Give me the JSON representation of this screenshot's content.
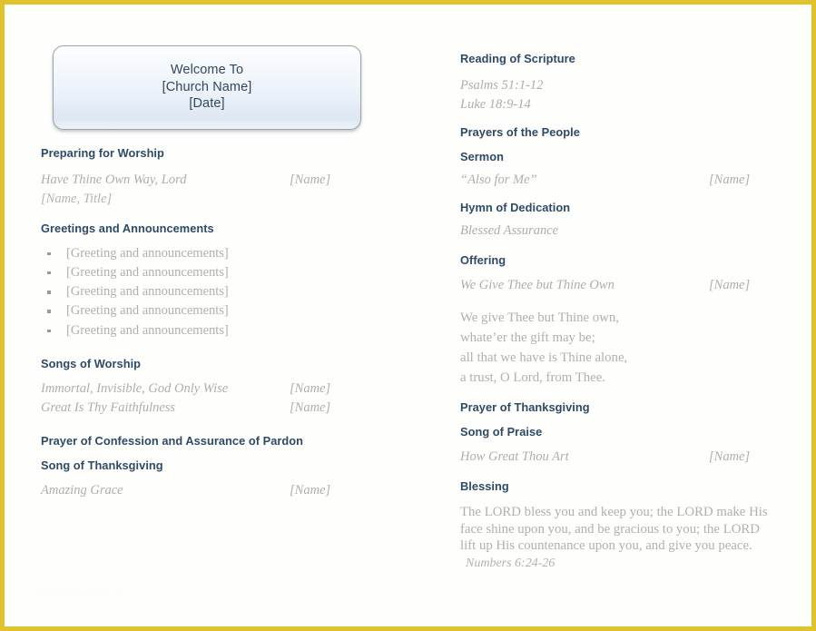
{
  "page": {
    "border_color": "#dfc22c",
    "background": "#fefefd",
    "heading_color": "#2d4a66",
    "body_color": "#b0b0b0",
    "watermark": "www.templateshub.com"
  },
  "welcome_box": {
    "line1": "Welcome To",
    "line2": "[Church Name]",
    "line3": "[Date]"
  },
  "left_column": {
    "preparing": {
      "heading": "Preparing for Worship",
      "song_title": "Have Thine Own Way, Lord",
      "song_name": "[Name]",
      "subline": "[Name, Title]"
    },
    "greetings": {
      "heading": "Greetings and Announcements",
      "items": [
        "[Greeting and announcements]",
        "[Greeting and announcements]",
        "[Greeting and announcements]",
        "[Greeting and announcements]",
        "[Greeting and announcements]"
      ]
    },
    "songs_of_worship": {
      "heading": "Songs of Worship",
      "entries": [
        {
          "title": "Immortal, Invisible, God Only Wise",
          "name": "[Name]"
        },
        {
          "title": "Great Is Thy Faithfulness",
          "name": "[Name]"
        }
      ]
    },
    "prayer_of_confession": {
      "heading": "Prayer of Confession and Assurance of Pardon"
    },
    "song_of_thanksgiving": {
      "heading": "Song of Thanksgiving",
      "entries": [
        {
          "title": "Amazing Grace",
          "name": "[Name]"
        }
      ]
    }
  },
  "right_column": {
    "reading_of_scripture": {
      "heading": "Reading of Scripture",
      "readings": [
        "Psalms 51:1-12",
        "Luke 18:9-14"
      ]
    },
    "prayers_of_the_people": {
      "heading": "Prayers of the People"
    },
    "sermon": {
      "heading": "Sermon",
      "title": "“Also for Me”",
      "name": "[Name]"
    },
    "hymn_of_dedication": {
      "heading": "Hymn of Dedication",
      "title": "Blessed Assurance"
    },
    "offering": {
      "heading": "Offering",
      "title": "We Give Thee but Thine Own",
      "name": "[Name]",
      "verse_lines": [
        "We give Thee but Thine own,",
        "whate’er the gift may be;",
        "all that we have is Thine alone,",
        "a trust, O Lord, from Thee."
      ]
    },
    "prayer_of_thanksgiving": {
      "heading": "Prayer of Thanksgiving"
    },
    "song_of_praise": {
      "heading": "Song of Praise",
      "title": "How Great Thou Art",
      "name": "[Name]"
    },
    "blessing": {
      "heading": "Blessing",
      "text": "The LORD bless you and keep you; the LORD make His face shine upon you, and be gracious to you; the LORD lift up His countenance upon you, and give you peace.",
      "citation": "Numbers 6:24-26"
    }
  }
}
